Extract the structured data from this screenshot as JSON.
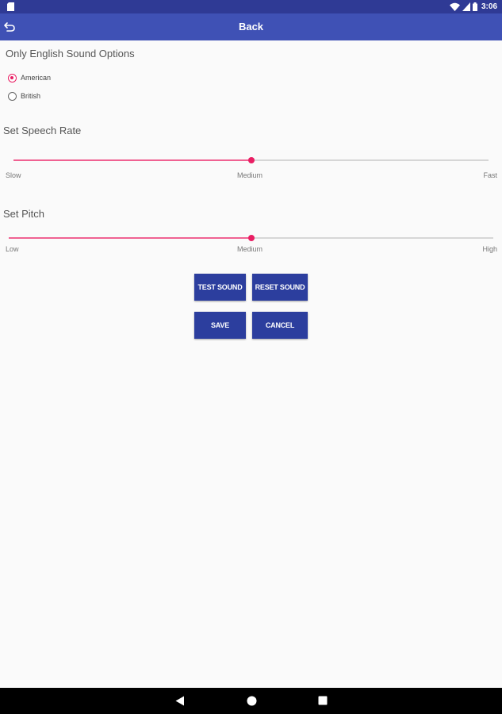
{
  "status_bar": {
    "time": "3:06"
  },
  "app_bar": {
    "title": "Back"
  },
  "sound_options": {
    "title": "Only English Sound Options",
    "options": [
      {
        "label": "American",
        "selected": true
      },
      {
        "label": "British",
        "selected": false
      }
    ]
  },
  "speech_rate": {
    "title": "Set Speech Rate",
    "value": 0.5,
    "labels": {
      "min": "Slow",
      "mid": "Medium",
      "max": "Fast"
    }
  },
  "pitch": {
    "title": "Set Pitch",
    "value": 0.5,
    "labels": {
      "min": "Low",
      "mid": "Medium",
      "max": "High"
    }
  },
  "buttons": {
    "test_sound": "TEST SOUND",
    "reset_sound": "RESET SOUND",
    "save": "SAVE",
    "cancel": "CANCEL"
  },
  "colors": {
    "status_bar": "#2f3a95",
    "app_bar": "#3f51b5",
    "accent": "#e91e63",
    "button": "#2c3e9e"
  },
  "icons": {
    "status_left": "sd-card-icon",
    "status_right": [
      "wifi-icon",
      "signal-icon",
      "battery-icon"
    ],
    "app_bar": "back-arrow-icon",
    "nav": [
      "back-triangle-icon",
      "home-circle-icon",
      "recents-square-icon"
    ]
  }
}
